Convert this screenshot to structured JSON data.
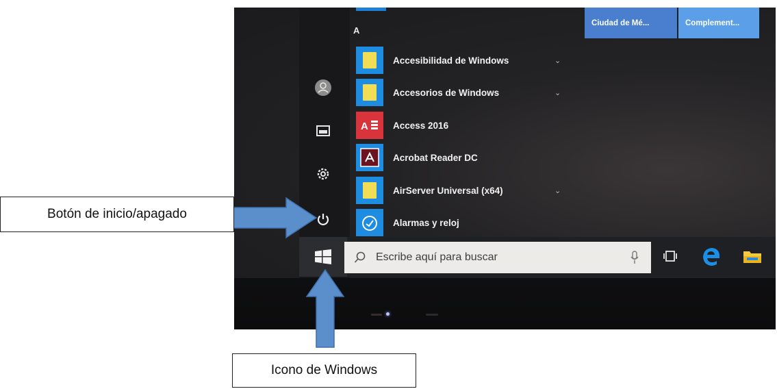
{
  "start_menu": {
    "section_letter": "A",
    "apps": [
      {
        "label": "Accesibilidad de Windows",
        "icon": "folder-icon",
        "expandable": true,
        "tile_color": "#1e8ce0"
      },
      {
        "label": "Accesorios de Windows",
        "icon": "folder-icon",
        "expandable": true,
        "tile_color": "#1e8ce0"
      },
      {
        "label": "Access 2016",
        "icon": "access-icon",
        "expandable": false,
        "tile_color": "#d9343c"
      },
      {
        "label": "Acrobat Reader DC",
        "icon": "acrobat-icon",
        "expandable": false,
        "tile_color": "#1e8ce0"
      },
      {
        "label": "AirServer Universal (x64)",
        "icon": "folder-icon",
        "expandable": true,
        "tile_color": "#1e8ce0"
      },
      {
        "label": "Alarmas y reloj",
        "icon": "alarm-clock-icon",
        "expandable": false,
        "tile_color": "#1e8ce0"
      }
    ],
    "chevron": "⌄",
    "live_tiles": [
      {
        "label": "Ciudad de Mé...",
        "color": "#4a7fd0"
      },
      {
        "label": "Complement...",
        "color": "#5a9fe8"
      }
    ]
  },
  "rail": {
    "icons": [
      "user-avatar-icon",
      "pictures-icon",
      "settings-gear-icon",
      "power-icon"
    ]
  },
  "taskbar": {
    "search_placeholder": "Escribe aquí para buscar",
    "icons": [
      "task-view-icon",
      "edge-icon",
      "file-explorer-icon"
    ]
  },
  "callouts": {
    "power_label": "Botón de inicio/apagado",
    "windows_label": "Icono de Windows"
  },
  "colors": {
    "arrow": "#5b8fcc",
    "arrow_outline": "#3e6fa8",
    "accent_blue": "#1e8ce0",
    "folder_yellow": "#f3dd57"
  }
}
